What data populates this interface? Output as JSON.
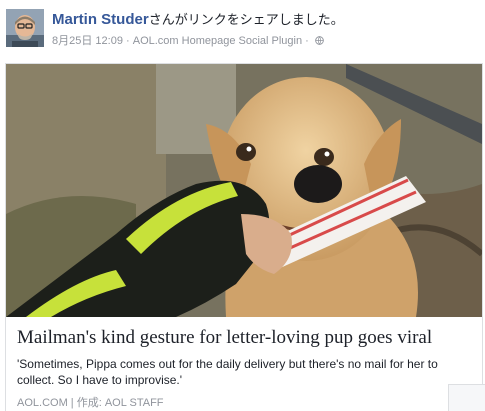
{
  "post": {
    "author": "Martin Studer",
    "action": "さんがリンクをシェアしました。",
    "date": "8月25日 12:09",
    "separator": "·",
    "source": "AOL.com Homepage Social Plugin",
    "separator2": "·",
    "icons": {
      "avatar": "user-avatar",
      "privacy": "globe-icon"
    }
  },
  "card": {
    "title": "Mailman's kind gesture for letter-loving pup goes viral",
    "description": "'Sometimes, Pippa comes out for the daily delivery but there's no mail for her to collect. So I have to improvise.'",
    "site": "AOL.COM",
    "divider": "|",
    "byline": "作成: AOL STAFF"
  },
  "colors": {
    "author_link": "#365899",
    "meta_gray": "#90949c",
    "text": "#1d2129"
  }
}
